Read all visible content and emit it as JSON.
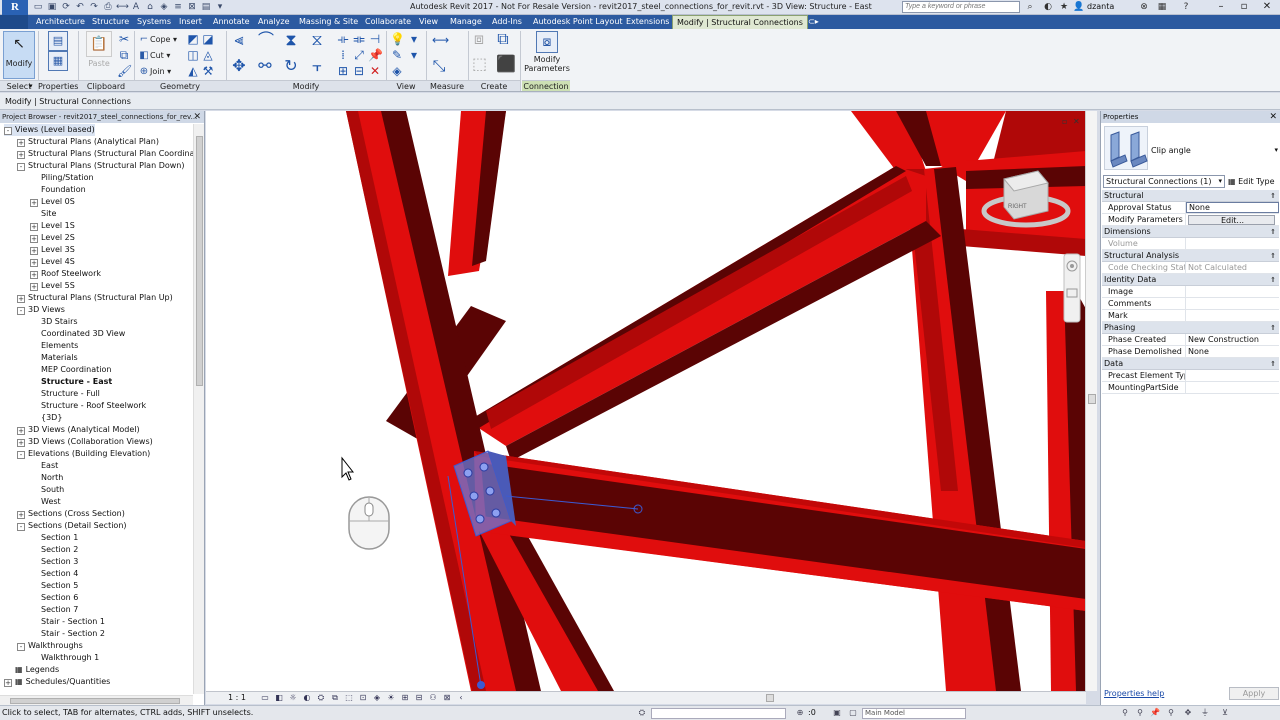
{
  "titlebar": {
    "app_logo": "R",
    "title": "Autodesk Revit 2017 - Not For Resale Version -     revit2017_steel_connections_for_revit.rvt - 3D View: Structure - East",
    "search_placeholder": "Type a keyword or phrase",
    "user": "dzanta"
  },
  "ribbon_tabs": [
    "Architecture",
    "Structure",
    "Systems",
    "Insert",
    "Annotate",
    "Analyze",
    "Massing & Site",
    "Collaborate",
    "View",
    "Manage",
    "Add-Ins",
    "Autodesk Point Layout",
    "Extensions",
    "Modify | Structural Connections"
  ],
  "ribbon": {
    "modify_label": "Modify",
    "paste_label": "Paste",
    "cope_label": "Cope",
    "cut_label": "Cut",
    "join_label": "Join",
    "modify_parameters_label": "Modify\nParameters",
    "modify_parameters_line1": "Modify",
    "modify_parameters_line2": "Parameters",
    "panels": {
      "select": "Select",
      "properties": "Properties",
      "clipboard": "Clipboard",
      "geometry": "Geometry",
      "modify": "Modify",
      "view": "View",
      "measure": "Measure",
      "create": "Create",
      "connection": "Connection"
    }
  },
  "context_bar": "Modify | Structural Connections",
  "project_browser": {
    "title": "Project Browser - revit2017_steel_connections_for_rev...",
    "nodes": [
      {
        "label": "Views (Level based)",
        "level": 0,
        "exp": "-"
      },
      {
        "label": "Structural Plans (Analytical Plan)",
        "level": 1,
        "exp": "+"
      },
      {
        "label": "Structural Plans (Structural Plan Coordination",
        "level": 1,
        "exp": "+"
      },
      {
        "label": "Structural Plans (Structural Plan Down)",
        "level": 1,
        "exp": "-"
      },
      {
        "label": "Piling/Station",
        "level": 2,
        "exp": ""
      },
      {
        "label": "Foundation",
        "level": 2,
        "exp": ""
      },
      {
        "label": "Level 0S",
        "level": 2,
        "exp": "+"
      },
      {
        "label": "Site",
        "level": 2,
        "exp": ""
      },
      {
        "label": "Level 1S",
        "level": 2,
        "exp": "+"
      },
      {
        "label": "Level 2S",
        "level": 2,
        "exp": "+"
      },
      {
        "label": "Level 3S",
        "level": 2,
        "exp": "+"
      },
      {
        "label": "Level 4S",
        "level": 2,
        "exp": "+"
      },
      {
        "label": "Roof Steelwork",
        "level": 2,
        "exp": "+"
      },
      {
        "label": "Level 5S",
        "level": 2,
        "exp": "+"
      },
      {
        "label": "Structural Plans (Structural Plan Up)",
        "level": 1,
        "exp": "+"
      },
      {
        "label": "3D Views",
        "level": 1,
        "exp": "-"
      },
      {
        "label": "3D Stairs",
        "level": 2,
        "exp": ""
      },
      {
        "label": "Coordinated 3D View",
        "level": 2,
        "exp": ""
      },
      {
        "label": "Elements",
        "level": 2,
        "exp": ""
      },
      {
        "label": "Materials",
        "level": 2,
        "exp": ""
      },
      {
        "label": "MEP Coordination",
        "level": 2,
        "exp": ""
      },
      {
        "label": "Structure - East",
        "level": 2,
        "exp": "",
        "bold": true
      },
      {
        "label": "Structure - Full",
        "level": 2,
        "exp": ""
      },
      {
        "label": "Structure - Roof Steelwork",
        "level": 2,
        "exp": ""
      },
      {
        "label": "{3D}",
        "level": 2,
        "exp": ""
      },
      {
        "label": "3D Views (Analytical Model)",
        "level": 1,
        "exp": "+"
      },
      {
        "label": "3D Views (Collaboration Views)",
        "level": 1,
        "exp": "+"
      },
      {
        "label": "Elevations (Building Elevation)",
        "level": 1,
        "exp": "-"
      },
      {
        "label": "East",
        "level": 2,
        "exp": ""
      },
      {
        "label": "North",
        "level": 2,
        "exp": ""
      },
      {
        "label": "South",
        "level": 2,
        "exp": ""
      },
      {
        "label": "West",
        "level": 2,
        "exp": ""
      },
      {
        "label": "Sections (Cross Section)",
        "level": 1,
        "exp": "+"
      },
      {
        "label": "Sections (Detail Section)",
        "level": 1,
        "exp": "-"
      },
      {
        "label": "Section 1",
        "level": 2,
        "exp": ""
      },
      {
        "label": "Section 2",
        "level": 2,
        "exp": ""
      },
      {
        "label": "Section 3",
        "level": 2,
        "exp": ""
      },
      {
        "label": "Section 4",
        "level": 2,
        "exp": ""
      },
      {
        "label": "Section 5",
        "level": 2,
        "exp": ""
      },
      {
        "label": "Section 6",
        "level": 2,
        "exp": ""
      },
      {
        "label": "Section 7",
        "level": 2,
        "exp": ""
      },
      {
        "label": "Stair - Section 1",
        "level": 2,
        "exp": ""
      },
      {
        "label": "Stair - Section 2",
        "level": 2,
        "exp": ""
      },
      {
        "label": "Walkthroughs",
        "level": 1,
        "exp": "-"
      },
      {
        "label": "Walkthrough 1",
        "level": 2,
        "exp": ""
      },
      {
        "label": "Legends",
        "level": 0,
        "exp": "",
        "icon": true
      },
      {
        "label": "Schedules/Quantities",
        "level": 0,
        "exp": "+",
        "icon": true
      }
    ]
  },
  "viewport": {
    "view_cube_label": "RIGHT",
    "scale": "1 : 1",
    "colors": {
      "steel": "#e00d0d",
      "steel_dark": "#5a0404",
      "steel_mid": "#b00808",
      "selection": "#3c5ad2"
    }
  },
  "properties": {
    "title": "Properties",
    "type_name": "Clip angle",
    "instance_selector": "Structural Connections (1)",
    "edit_type": "Edit Type",
    "groups": [
      {
        "name": "Structural",
        "rows": [
          {
            "name": "Approval Status",
            "value": "None",
            "style": "field"
          },
          {
            "name": "Modify Parameters",
            "value": "Edit...",
            "style": "btn"
          }
        ]
      },
      {
        "name": "Dimensions",
        "rows": [
          {
            "name": "Volume",
            "value": "",
            "style": "dim"
          }
        ]
      },
      {
        "name": "Structural Analysis",
        "rows": [
          {
            "name": "Code Checking Status",
            "value": "Not Calculated",
            "style": "dim"
          }
        ]
      },
      {
        "name": "Identity Data",
        "rows": [
          {
            "name": "Image",
            "value": ""
          },
          {
            "name": "Comments",
            "value": ""
          },
          {
            "name": "Mark",
            "value": ""
          }
        ]
      },
      {
        "name": "Phasing",
        "rows": [
          {
            "name": "Phase Created",
            "value": "New Construction"
          },
          {
            "name": "Phase Demolished",
            "value": "None"
          }
        ]
      },
      {
        "name": "Data",
        "rows": [
          {
            "name": "Precast Element Type",
            "value": ""
          },
          {
            "name": "MountingPartSide",
            "value": ""
          }
        ]
      }
    ],
    "help_link": "Properties help",
    "apply": "Apply"
  },
  "statusbar": {
    "text": "Click to select, TAB for alternates, CTRL adds, SHIFT unselects.",
    "zero": ":0",
    "model": "Main Model"
  }
}
